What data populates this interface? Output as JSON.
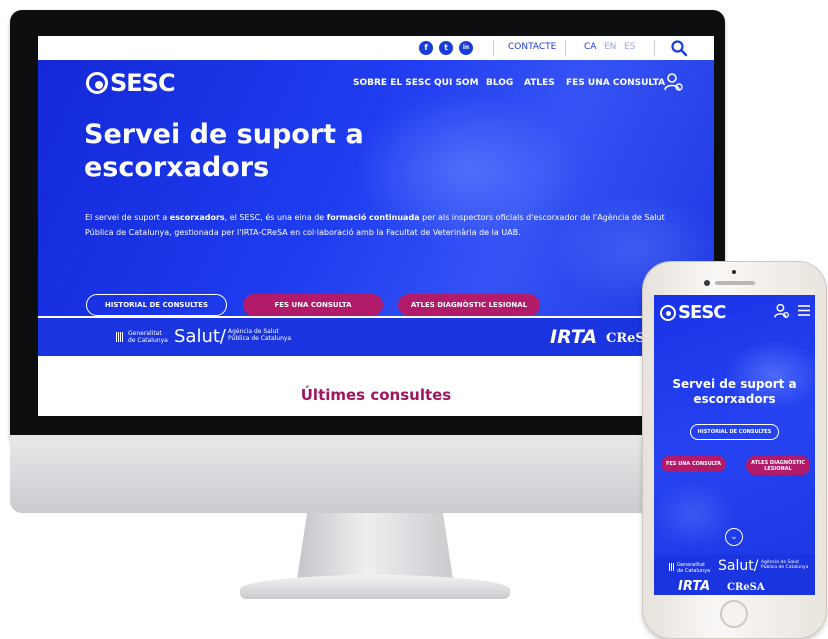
{
  "desktop": {
    "topbar": {
      "social": [
        {
          "icon": "facebook-icon",
          "glyph": "f"
        },
        {
          "icon": "twitter-icon",
          "glyph": "t"
        },
        {
          "icon": "linkedin-icon",
          "glyph": "in"
        }
      ],
      "contact": "CONTACTE",
      "languages": [
        "CA",
        "EN",
        "ES"
      ],
      "search_icon": "search-icon"
    },
    "header": {
      "logo_text": "SESC",
      "nav": [
        "SOBRE EL SESC",
        "QUI SOM",
        "BLOG",
        "ATLES",
        "FES UNA CONSULTA"
      ],
      "user_icon": "user-settings-icon"
    },
    "hero": {
      "title_line1": "Servei de suport a",
      "title_line2": "escorxadors",
      "text_1": "El servei de suport a ",
      "text_bold_1": "escorxadors",
      "text_2": ", el SESC,  és una eina de ",
      "text_bold_2": "formació continuada",
      "text_3": " per als inspectors oficials d'escorxador de l'Agència de Salut Pública de Catalunya, gestionada per l'IRTA-CReSA en col·laboració amb la Facultat de Veterinària de la UAB.",
      "buttons": [
        "HISTORIAL DE CONSULTES",
        "FES UNA CONSULTA",
        "ATLES DIAGNÒSTIC LESIONAL"
      ]
    },
    "partners": {
      "generalitat": [
        "Generalitat",
        "de Catalunya"
      ],
      "salut": "Salut/",
      "salut_sub": [
        "Agència de Salut",
        "Pública de Catalunya"
      ],
      "irta": "IRTA",
      "cresa": "CReSA"
    },
    "section_title": "Últimes consultes"
  },
  "mobile": {
    "logo_text": "SESC",
    "title_line1": "Servei de suport a",
    "title_line2": "escorxadors",
    "buttons": {
      "historial": "HISTORIAL DE CONSULTES",
      "consulta": "FES UNA CONSULTA",
      "atles_line1": "ATLES DIAGNÒSTIC",
      "atles_line2": "LESIONAL"
    },
    "scroll_glyph": "⌄",
    "partners": {
      "generalitat": [
        "Generalitat",
        "de Catalunya"
      ],
      "salut": "Salut/",
      "salut_sub": [
        "Agència de Salut",
        "Pública de Catalunya"
      ],
      "irta": "IRTA",
      "cresa": "CReSA"
    }
  },
  "colors": {
    "brand_blue": "#1a3cd8",
    "accent_pink": "#b21a6a",
    "title_magenta": "#a0165e"
  }
}
